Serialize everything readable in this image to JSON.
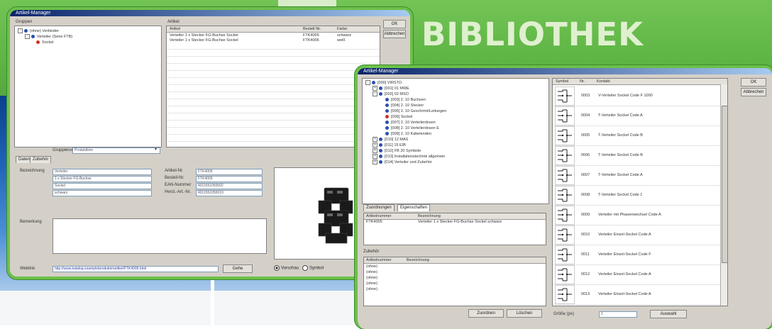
{
  "banner": {
    "title": "BIBLIOTHEK"
  },
  "win1": {
    "title": "Artikel-Manager",
    "tree_header": "Gruppen",
    "tree": [
      {
        "label": "(ohne) Verbinder",
        "level": 0,
        "mark": "blue"
      },
      {
        "label": "Verteiler (Serie FTB)",
        "level": 1,
        "mark": "blue"
      },
      {
        "label": "Sockel",
        "level": 2,
        "mark": "red"
      }
    ],
    "table_header": "Artikel",
    "columns": [
      "Artikel",
      "Bestell-Nr.",
      "Farbe"
    ],
    "rows": [
      [
        "Verteiler 1 x Stecker FG-Buchse Sockel",
        "FTK4005",
        "schwarz"
      ],
      [
        "Verteiler 1 x Stecker FG-Buchse Sockel",
        "FTK4006",
        "weiß"
      ]
    ],
    "filter_label": "Gruppierung",
    "filter_value": "Produktlinie",
    "tabs": [
      "Daten",
      "Zubehör"
    ],
    "labels": {
      "bezeichnung": "Bezeichnung",
      "bemerkung": "Bemerkung",
      "link": "Weblink",
      "artnr": "Artikel-Nr.",
      "bestellnr": "Bestell-Nr.",
      "ean": "EAN-Nummer",
      "hersteller": "Herst.-Art.-Nr."
    },
    "fields": {
      "bez1": "Verteiler",
      "bez2": "1 x Stecker FG-Buchse",
      "bez3": "Sockel",
      "bez4": "schwarz",
      "artnr": "FTK4005",
      "bestellnr": "FTK4005",
      "ean": "4011551050002",
      "hersteller": "4011551050019"
    },
    "link_value": "http://www.katalog.example/produkte/artikel/FTK4005.html",
    "link_button": "Gehe",
    "radio": [
      "Vorschau",
      "Symbol"
    ],
    "side_buttons": [
      "OK",
      "Abbrechen"
    ]
  },
  "win2": {
    "title": "Artikel-Manager",
    "tree": [
      {
        "label": "[000] VIRSTO",
        "level": 0,
        "mark": "blue",
        "sign": "-"
      },
      {
        "label": "[001] 01 MWE",
        "level": 1,
        "mark": "blue",
        "sign": "+"
      },
      {
        "label": "[002] 02 MSO",
        "level": 1,
        "mark": "blue",
        "sign": "-"
      },
      {
        "label": "[003] 2. 10 Buchsen",
        "level": 2,
        "mark": "blue"
      },
      {
        "label": "[004] 2. 10 Stecker",
        "level": 2,
        "mark": "blue"
      },
      {
        "label": "[005] 2. 10 Geschirmt/Leitungen",
        "level": 2,
        "mark": "blue"
      },
      {
        "label": "[006] Sockel",
        "level": 2,
        "mark": "red"
      },
      {
        "label": "[007] 2. 10 Verteilerdosen",
        "level": 2,
        "mark": "blue"
      },
      {
        "label": "[008] 2. 10 Verteilerdosen E",
        "level": 2,
        "mark": "blue"
      },
      {
        "label": "[009] 2. 10 Kabelenden",
        "level": 2,
        "mark": "blue"
      },
      {
        "label": "[010] 12 MAS",
        "level": 1,
        "mark": "blue",
        "sign": "+"
      },
      {
        "label": "[011] 15 EIB",
        "level": 1,
        "mark": "blue",
        "sign": "+"
      },
      {
        "label": "[012] FB 20 Symbole",
        "level": 1,
        "mark": "blue",
        "sign": "+"
      },
      {
        "label": "[013] Installationstechnik allgemein",
        "level": 1,
        "mark": "blue",
        "sign": "+"
      },
      {
        "label": "[014] Verteiler und Zubehör",
        "level": 1,
        "mark": "blue",
        "sign": "+"
      }
    ],
    "tabs": [
      "Zuordnungen",
      "Eigenschaften"
    ],
    "assign_columns": [
      "Artikelnummer",
      "Bezeichnung"
    ],
    "assign_rows": [
      [
        "FTK4005",
        "Verteiler 1 x Stecker FG-Buchse Sockel schwarz"
      ]
    ],
    "section2": "Zubehör",
    "accessory_columns": [
      "Artikelnummer",
      "Bezeichnung"
    ],
    "accessory_rows": [
      [
        "(ohne)",
        ""
      ],
      [
        "(ohne)",
        ""
      ],
      [
        "(ohne)",
        ""
      ],
      [
        "(ohne)",
        ""
      ],
      [
        "(ohne)",
        ""
      ]
    ],
    "bottom_buttons": [
      "Zuordnen",
      "Löschen"
    ],
    "symbol_columns": [
      "Symbol",
      "Nr.",
      "Kontakt"
    ],
    "symbol_rows": [
      {
        "nr": "0003",
        "text": "V-Verteiler Sockel Code F 1000"
      },
      {
        "nr": "0004",
        "text": "T-Verteiler Sockel Code A"
      },
      {
        "nr": "0005",
        "text": "T-Verteiler Sockel Code B"
      },
      {
        "nr": "0006",
        "text": "T-Verteiler Sockel Code B"
      },
      {
        "nr": "0007",
        "text": "T-Verteiler Sockel Code A"
      },
      {
        "nr": "0008",
        "text": "T-Verteiler Sockel Code 1"
      },
      {
        "nr": "0009",
        "text": "Verteiler mit Phasenwechsel Code A"
      },
      {
        "nr": "0010",
        "text": "Verteiler Einzel-Sockel Code A"
      },
      {
        "nr": "0011",
        "text": "Verteiler Einzel-Sockel Code F"
      },
      {
        "nr": "0012",
        "text": "Verteiler Einzel-Sockel Code A"
      },
      {
        "nr": "0013",
        "text": "Verteiler Einzel-Sockel Code A"
      }
    ],
    "zoom_label": "Größe (px)",
    "zoom_value": "1",
    "zoom_button": "Auswahl",
    "side_buttons": [
      "OK",
      "Abbrechen"
    ]
  }
}
